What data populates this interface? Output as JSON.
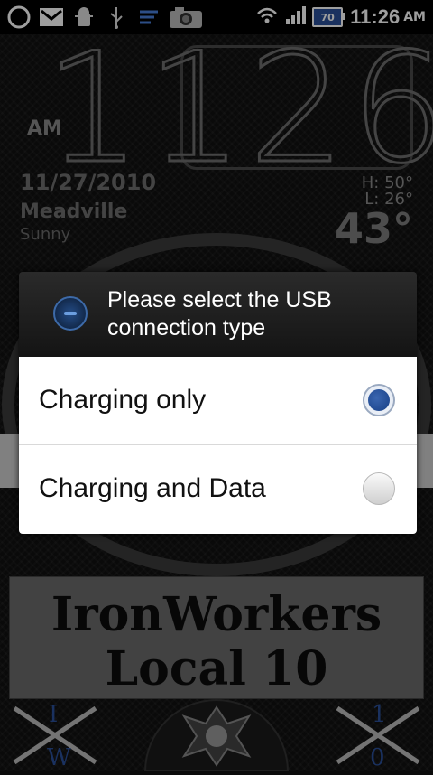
{
  "status_bar": {
    "icons": [
      "ring-icon",
      "gmail-icon",
      "android-debug-icon",
      "usb-icon",
      "notes-icon",
      "camera-icon",
      "wifi-icon",
      "signal-icon"
    ],
    "battery_level": "70",
    "time": "11:26",
    "ampm": "AM"
  },
  "clock_widget": {
    "hours": "11",
    "minutes": "26",
    "ampm": "AM",
    "date": "11/27/2010",
    "city": "Meadville",
    "condition": "Sunny",
    "high": "H:  50°",
    "low": "L:  26°",
    "temperature": "43°"
  },
  "banner": {
    "line1": "IronWorkers",
    "line2": "Local 10"
  },
  "dock": {
    "left_letters": [
      "I",
      "W"
    ],
    "right_letters": [
      "1",
      "0"
    ]
  },
  "dialog": {
    "title": "Please select the USB connection type",
    "options": [
      {
        "label": "Charging only",
        "selected": true
      },
      {
        "label": "Charging and Data",
        "selected": false
      }
    ]
  },
  "colors": {
    "accent_blue": "#2a4f9a",
    "radio_selected": "#1f4a94"
  }
}
